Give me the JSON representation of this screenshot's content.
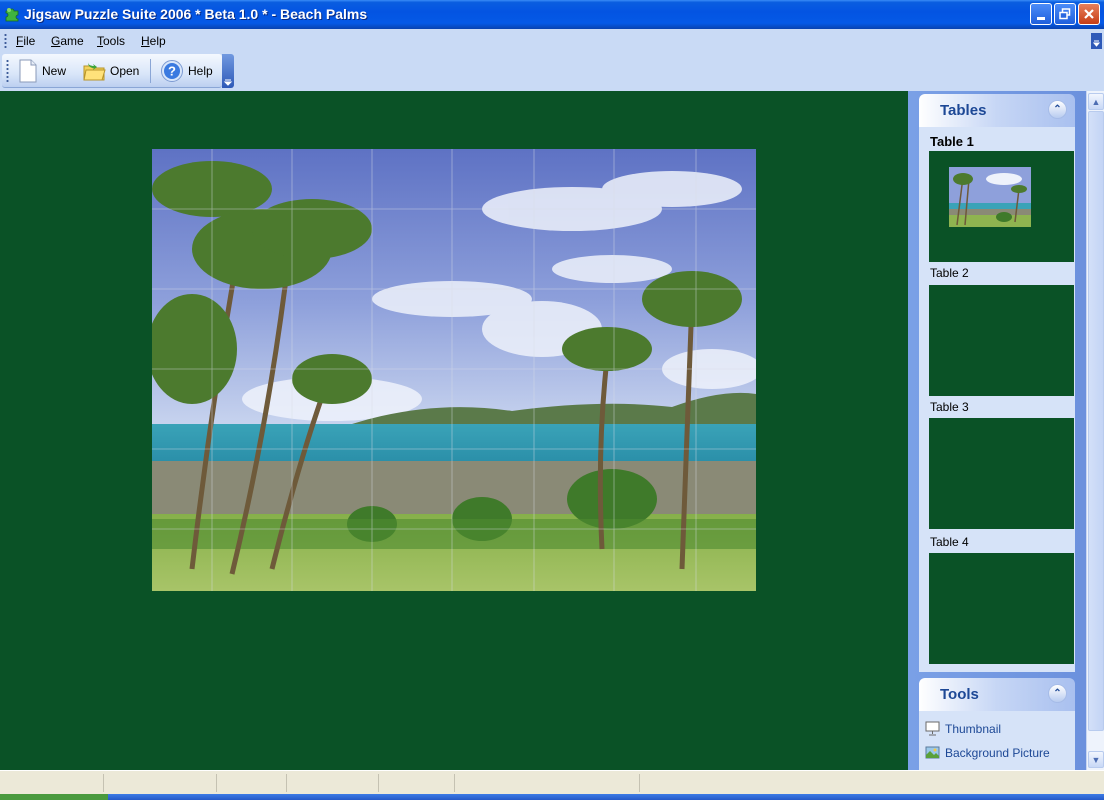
{
  "window": {
    "title": "Jigsaw Puzzle Suite 2006 * Beta 1.0 * - Beach Palms",
    "app_icon": "puzzle-piece-icon",
    "controls": {
      "minimize": "minimize-icon",
      "restore": "restore-icon",
      "close": "close-icon"
    }
  },
  "menubar": {
    "items": [
      {
        "label": "File",
        "accel": "F",
        "rest": "ile"
      },
      {
        "label": "Game",
        "accel": "G",
        "rest": "ame"
      },
      {
        "label": "Tools",
        "accel": "T",
        "rest": "ools"
      },
      {
        "label": "Help",
        "accel": "H",
        "rest": "elp"
      }
    ]
  },
  "toolbar": {
    "buttons": [
      {
        "label": "New",
        "icon": "new-document-icon"
      },
      {
        "label": "Open",
        "icon": "open-folder-icon"
      },
      {
        "label": "Help",
        "icon": "help-icon"
      }
    ]
  },
  "puzzle": {
    "name": "Beach Palms",
    "grid_columns": 7.5,
    "grid_rows": 5.5
  },
  "side_panel": {
    "tables_group": {
      "title": "Tables",
      "collapse_icon": "chevron-double-up-icon",
      "tables": [
        {
          "label": "Table 1",
          "active": true,
          "has_puzzle": true
        },
        {
          "label": "Table 2",
          "active": false,
          "has_puzzle": false
        },
        {
          "label": "Table 3",
          "active": false,
          "has_puzzle": false
        },
        {
          "label": "Table 4",
          "active": false,
          "has_puzzle": false
        }
      ]
    },
    "tools_group": {
      "title": "Tools",
      "collapse_icon": "chevron-double-up-icon",
      "items": [
        {
          "label": "Thumbnail",
          "icon": "thumbnail-icon"
        },
        {
          "label": "Background Picture",
          "icon": "background-picture-icon"
        }
      ]
    }
  },
  "colors": {
    "table_felt": "#0a5226",
    "titlebar": "#0454e2",
    "panel_blue": "#6a8fdc",
    "group_title": "#1d4896",
    "statusbar": "#ece9d8"
  }
}
